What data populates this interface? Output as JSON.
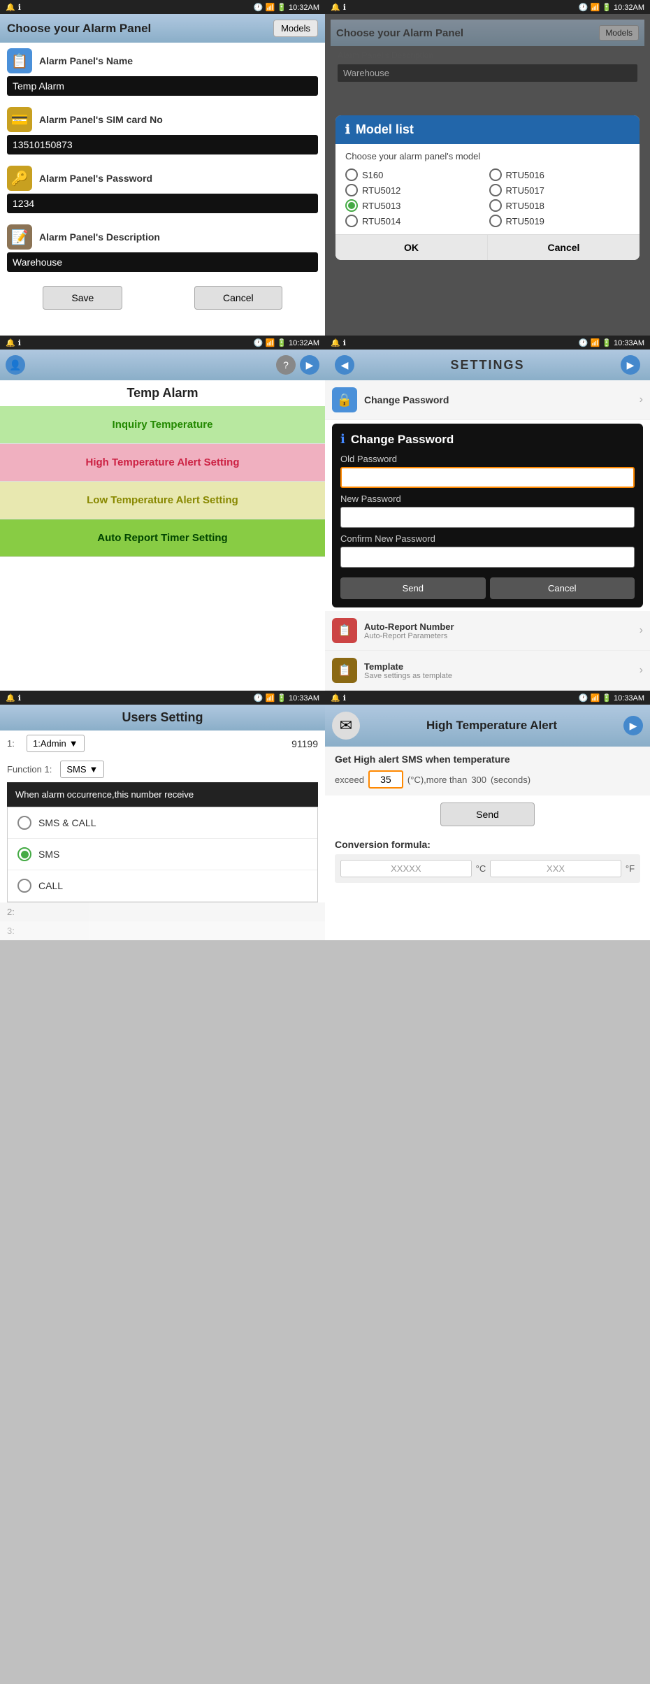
{
  "screens": {
    "s1": {
      "status_left": "🔔 ℹ",
      "status_right": "🕐 📶 🔋 10:32AM",
      "title": "Choose your Alarm Panel",
      "models_btn": "Models",
      "fields": [
        {
          "label": "Alarm Panel's Name",
          "value": "Temp Alarm",
          "icon": "📋"
        },
        {
          "label": "Alarm Panel's SIM card No",
          "value": "13510150873",
          "icon": "💳"
        },
        {
          "label": "Alarm Panel's Password",
          "value": "1234",
          "icon": "🔑"
        },
        {
          "label": "Alarm Panel's Description",
          "value": "Warehouse",
          "icon": "📝"
        }
      ],
      "save_btn": "Save",
      "cancel_btn": "Cancel"
    },
    "s2": {
      "status_right": "🕐 📶 🔋 10:32AM",
      "dialog_title": "Model list",
      "dialog_sub": "Choose your alarm panel's model",
      "models": [
        {
          "id": "S160",
          "selected": false
        },
        {
          "id": "RTU5016",
          "selected": false
        },
        {
          "id": "RTU5012",
          "selected": false
        },
        {
          "id": "RTU5017",
          "selected": false
        },
        {
          "id": "RTU5013",
          "selected": true
        },
        {
          "id": "RTU5018",
          "selected": false
        },
        {
          "id": "RTU5014",
          "selected": false
        },
        {
          "id": "RTU5019",
          "selected": false
        }
      ],
      "ok_btn": "OK",
      "cancel_btn": "Cancel"
    },
    "s3": {
      "status_right": "🕐 📶 🔋 10:32AM",
      "title": "Temp Alarm",
      "menu_items": [
        {
          "label": "Inquiry Temperature",
          "style": "green"
        },
        {
          "label": "High Temperature Alert Setting",
          "style": "pink"
        },
        {
          "label": "Low Temperature Alert Setting",
          "style": "yellow"
        },
        {
          "label": "Auto Report Timer Setting",
          "style": "bright-green"
        }
      ]
    },
    "s4": {
      "status_right": "🕐 📶 🔋 10:33AM",
      "settings_title": "SETTINGS",
      "change_password_label": "Change Password",
      "dialog_title": "Change Password",
      "old_password_label": "Old Password",
      "new_password_label": "New Password",
      "confirm_password_label": "Confirm New Password",
      "send_btn": "Send",
      "cancel_btn": "Cancel",
      "bottom_items": [
        {
          "title": "Auto-Report Number",
          "sub": "Auto-Report Parameters",
          "icon": "📋"
        },
        {
          "title": "Template",
          "sub": "Save settings as template",
          "icon": "📋"
        }
      ]
    },
    "s5": {
      "status_right": "🕐 📶 🔋 10:33AM",
      "title": "Users Setting",
      "row1_num": "1:",
      "row1_select": "1:Admin",
      "row1_value": "91199",
      "fn_label": "Function 1:",
      "fn_value": "SMS",
      "tooltip": "When alarm occurrence,this number receive",
      "dropdown_items": [
        {
          "label": "SMS & CALL",
          "selected": false
        },
        {
          "label": "SMS",
          "selected": true
        },
        {
          "label": "CALL",
          "selected": false
        }
      ],
      "row2_num": "2:",
      "row3_num": "3:"
    },
    "s6": {
      "status_right": "🕐 📶 🔋 10:33AM",
      "page_title": "High Temperature Alert",
      "section_title": "Get High alert SMS when temperature",
      "exceed_label": "exceed",
      "exceed_value": "35",
      "celsius_label": "(°C),more than",
      "seconds_value": "300",
      "seconds_label": "(seconds)",
      "send_btn": "Send",
      "formula_title": "Conversion formula:",
      "formula_placeholder": "XXXXX",
      "formula_c": "°C",
      "formula_xxx": "XXX",
      "formula_f": "°F"
    }
  }
}
